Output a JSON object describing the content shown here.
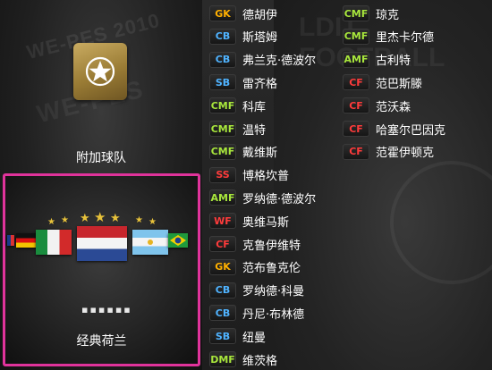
{
  "colors": {
    "GK": "#ffb000",
    "CB": "#4fb3ff",
    "SB": "#4fb3ff",
    "CMF": "#a8e63c",
    "AMF": "#a8e63c",
    "DMF": "#a8e63c",
    "CF": "#ff3b3b",
    "SS": "#ff3b3b",
    "WF": "#ff3b3b",
    "accent_frame": "#e0339b",
    "badge_gold": "#b99648"
  },
  "left": {
    "extra_team_label": "附加球队",
    "extra_team_icon": "star-badge-icon",
    "classic_team_label": "经典荷兰",
    "page_dots": "▪▪▪▪▪▪",
    "flags": [
      "germany-flag-icon",
      "italy-flag-icon",
      "netherlands-flag-icon",
      "argentina-flag-icon",
      "brazil-flag-icon"
    ]
  },
  "roster_col1": [
    {
      "pos": "GK",
      "name": "德胡伊"
    },
    {
      "pos": "CB",
      "name": "斯塔姆"
    },
    {
      "pos": "CB",
      "name": "弗兰克·德波尔"
    },
    {
      "pos": "SB",
      "name": "雷齐格"
    },
    {
      "pos": "CMF",
      "name": "科库"
    },
    {
      "pos": "CMF",
      "name": "温特"
    },
    {
      "pos": "CMF",
      "name": "戴维斯"
    },
    {
      "pos": "SS",
      "name": "博格坎普"
    },
    {
      "pos": "AMF",
      "name": "罗纳德·德波尔"
    },
    {
      "pos": "WF",
      "name": "奥维马斯"
    },
    {
      "pos": "CF",
      "name": "克鲁伊维特"
    },
    {
      "pos": "GK",
      "name": "范布鲁克伦"
    },
    {
      "pos": "CB",
      "name": "罗纳德·科曼"
    },
    {
      "pos": "CB",
      "name": "丹尼·布林德"
    },
    {
      "pos": "SB",
      "name": "纽曼"
    },
    {
      "pos": "DMF",
      "name": "维茨格"
    }
  ],
  "roster_col2": [
    {
      "pos": "CMF",
      "name": "琼克"
    },
    {
      "pos": "CMF",
      "name": "里杰卡尔德"
    },
    {
      "pos": "AMF",
      "name": "古利特"
    },
    {
      "pos": "CF",
      "name": "范巴斯滕"
    },
    {
      "pos": "CF",
      "name": "范沃森"
    },
    {
      "pos": "CF",
      "name": "哈塞尔巴因克"
    },
    {
      "pos": "CF",
      "name": "范霍伊顿克"
    }
  ]
}
